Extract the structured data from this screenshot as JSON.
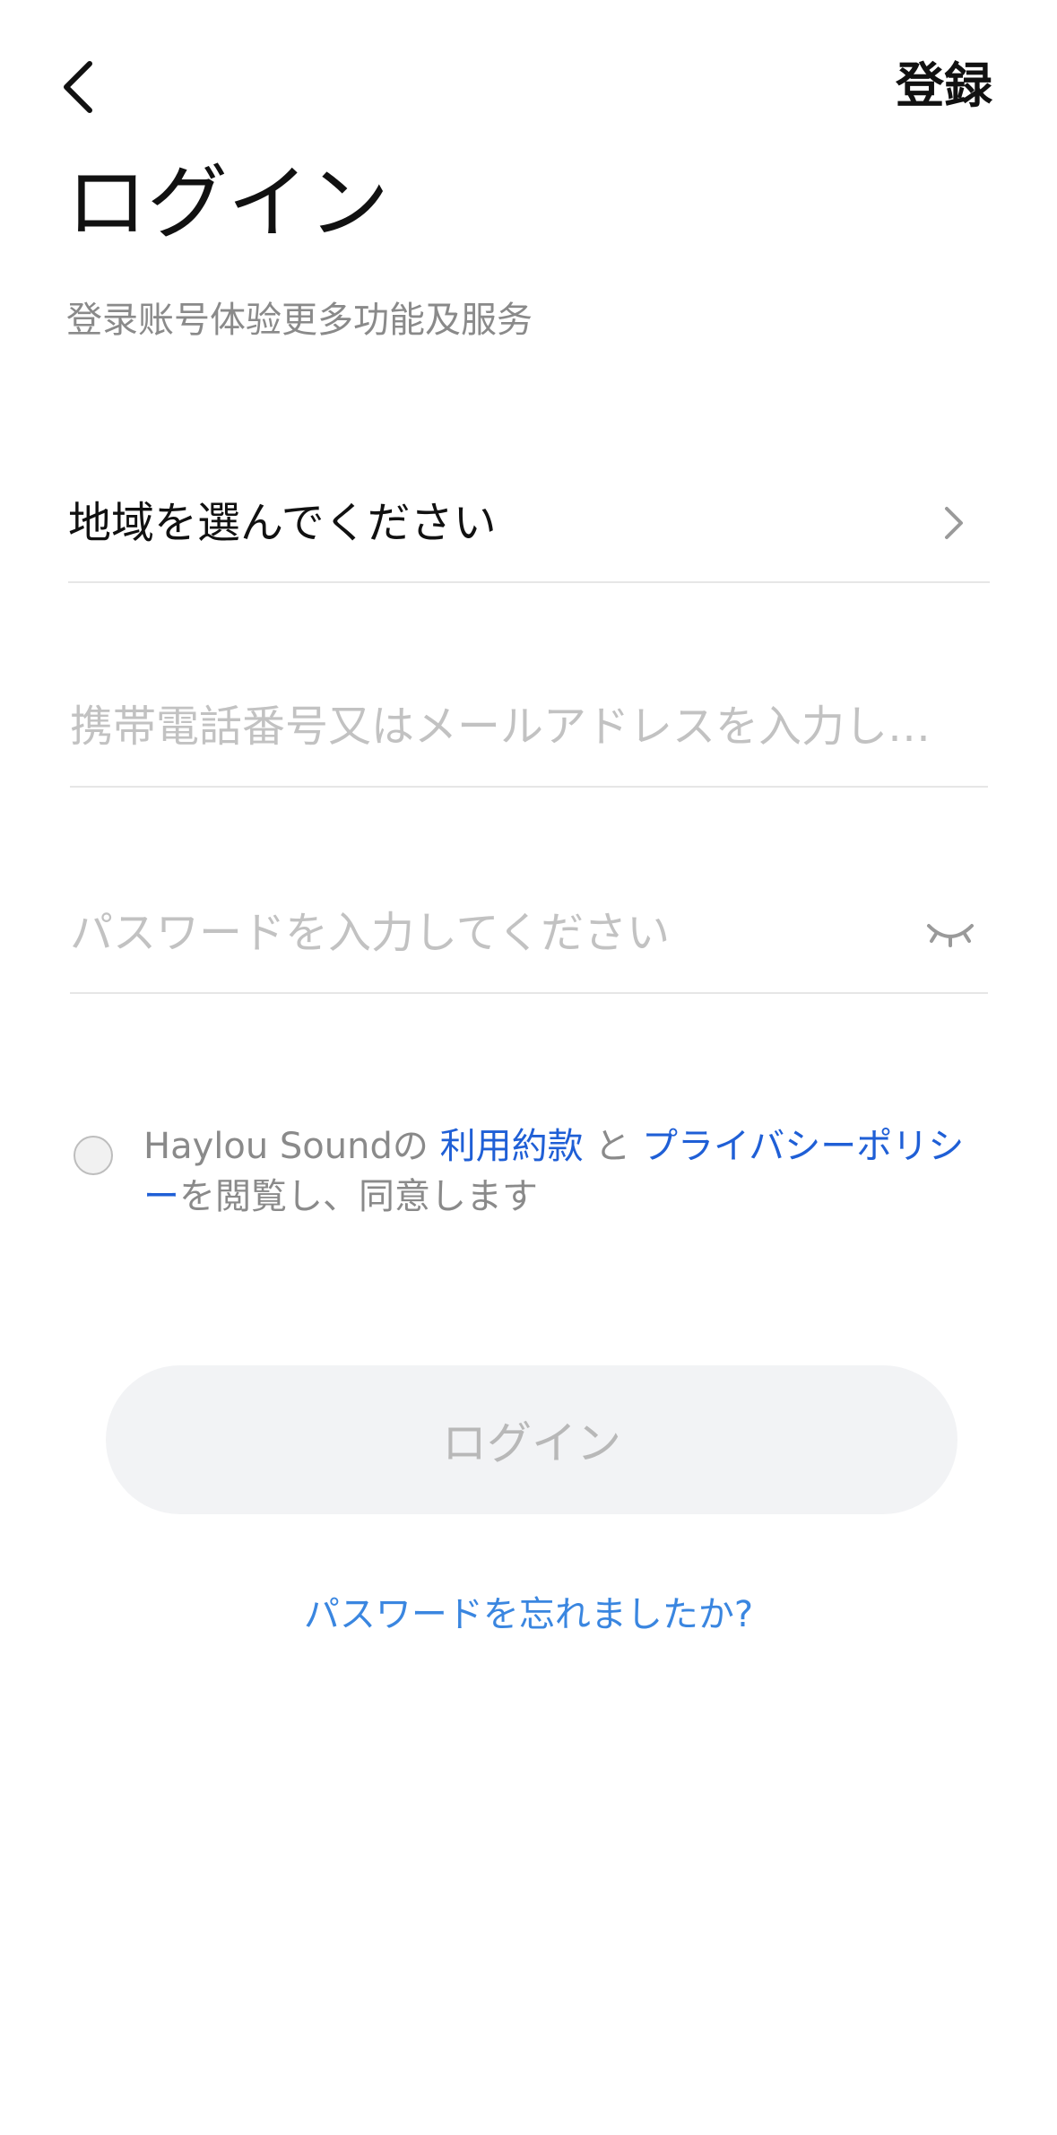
{
  "header": {
    "back_icon": "chevron-left-icon",
    "register_label": "登録"
  },
  "title": "ログイン",
  "subtitle": "登录账号体验更多功能及服务",
  "region": {
    "label": "地域を選んでください",
    "icon": "chevron-right-icon"
  },
  "account_field": {
    "value": "",
    "placeholder": "携帯電話番号又はメールアドレスを入力し…"
  },
  "password_field": {
    "value": "",
    "placeholder": "パスワードを入力してください",
    "toggle_icon": "eye-closed-icon"
  },
  "agreement": {
    "checked": false,
    "prefix": "Haylou Soundの ",
    "terms_link": "利用約款",
    "conjunction": " と ",
    "privacy_link": "プライバシーポリシー",
    "suffix": "を閲覧し、同意します"
  },
  "login_button": {
    "label": "ログイン",
    "enabled": false
  },
  "forgot_password": "パスワードを忘れましたか?",
  "colors": {
    "link_blue": "#1f5fd6",
    "forgot_blue": "#3a86e0",
    "disabled_button_bg": "#f2f3f5",
    "disabled_button_text": "#b8b8b8"
  }
}
